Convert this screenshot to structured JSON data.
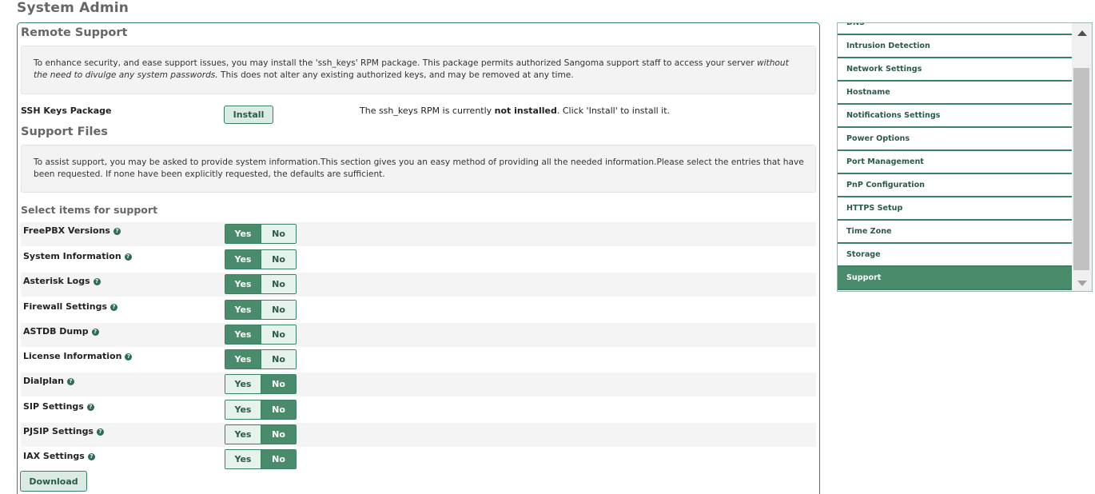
{
  "page": {
    "title": "System Admin"
  },
  "remote_support": {
    "title": "Remote Support",
    "info_before": "To enhance security, and ease support issues, you may install the 'ssh_keys' RPM package. This package permits authorized Sangoma support staff to access your server ",
    "info_italic": "without the need to divulge any system passwords.",
    "info_after": " This does not alter any existing authorized keys, and may be removed at any time.",
    "ssh_label": "SSH Keys Package",
    "install_label": "Install",
    "status_before": "The ssh_keys RPM is currently ",
    "status_bold": "not installed",
    "status_after": ". Click 'Install' to install it."
  },
  "support_files": {
    "title": "Support Files",
    "info": "To assist support, you may be asked to provide system information.This section gives you an easy method of providing all the needed information.Please select the entries that have been requested. If none have been explicitly requested, the defaults are sufficient.",
    "select_heading": "Select items for support",
    "yes_label": "Yes",
    "no_label": "No",
    "items": [
      {
        "label": "FreePBX Versions",
        "selected": "yes"
      },
      {
        "label": "System Information",
        "selected": "yes"
      },
      {
        "label": "Asterisk Logs",
        "selected": "yes"
      },
      {
        "label": "Firewall Settings",
        "selected": "yes"
      },
      {
        "label": "ASTDB Dump",
        "selected": "yes"
      },
      {
        "label": "License Information",
        "selected": "yes"
      },
      {
        "label": "Dialplan",
        "selected": "no"
      },
      {
        "label": "SIP Settings",
        "selected": "no"
      },
      {
        "label": "PJSIP Settings",
        "selected": "no"
      },
      {
        "label": "IAX Settings",
        "selected": "no"
      }
    ],
    "download_label": "Download"
  },
  "sidebar": {
    "items": [
      {
        "label": "DNS",
        "active": false
      },
      {
        "label": "Intrusion Detection",
        "active": false
      },
      {
        "label": "Network Settings",
        "active": false
      },
      {
        "label": "Hostname",
        "active": false
      },
      {
        "label": "Notifications Settings",
        "active": false
      },
      {
        "label": "Power Options",
        "active": false
      },
      {
        "label": "Port Management",
        "active": false
      },
      {
        "label": "PnP Configuration",
        "active": false
      },
      {
        "label": "HTTPS Setup",
        "active": false
      },
      {
        "label": "Time Zone",
        "active": false
      },
      {
        "label": "Storage",
        "active": false
      },
      {
        "label": "Support",
        "active": true
      }
    ]
  },
  "colors": {
    "accent": "#4a8b6b",
    "border": "#3d8067",
    "text_green": "#2c5a47"
  },
  "icons": {
    "help": "question-circle-icon",
    "scroll_up": "scroll-up-arrow-icon",
    "scroll_down": "scroll-down-arrow-icon"
  }
}
